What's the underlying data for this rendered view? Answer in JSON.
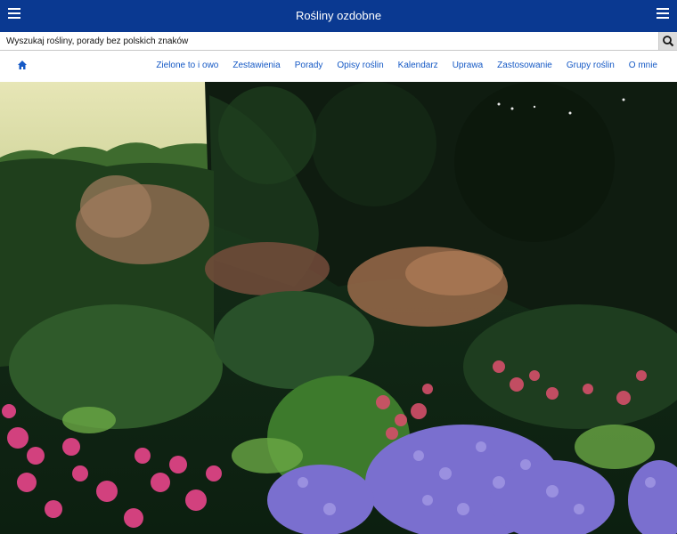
{
  "header": {
    "title": "Rośliny ozdobne",
    "left_menu_icon": "hamburger-menu-icon",
    "right_menu_icon": "hamburger-menu-icon",
    "background": "#0a3991"
  },
  "search": {
    "placeholder": "Wyszukaj rośliny, porady bez polskich znaków",
    "value": "",
    "button_icon": "search-icon"
  },
  "nav": {
    "home_icon": "home-icon",
    "link_color": "#1559c5",
    "items": [
      {
        "label": "Zielone to i owo"
      },
      {
        "label": "Zestawienia"
      },
      {
        "label": "Porady"
      },
      {
        "label": "Opisy roślin"
      },
      {
        "label": "Kalendarz"
      },
      {
        "label": "Uprawa"
      },
      {
        "label": "Zastosowanie"
      },
      {
        "label": "Grupy roślin"
      },
      {
        "label": "O mnie"
      }
    ]
  }
}
